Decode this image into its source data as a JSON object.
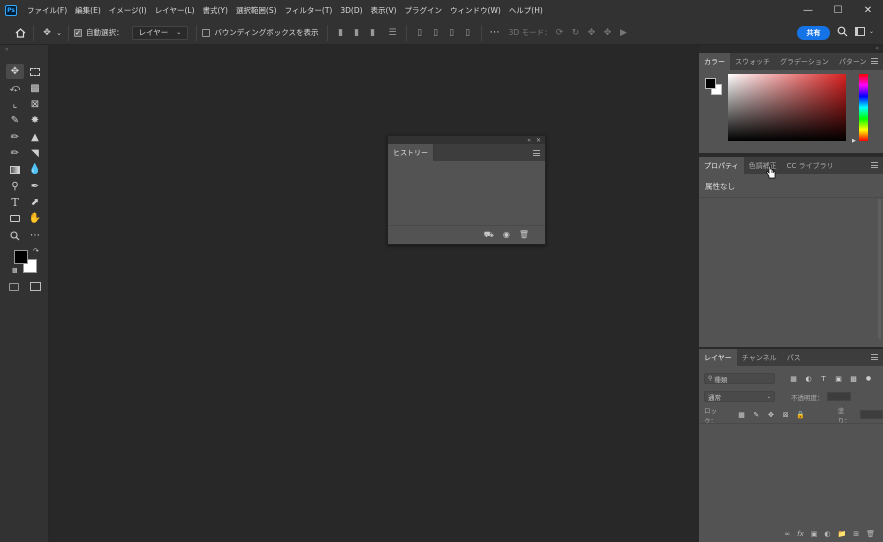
{
  "titlebar": {
    "app_icon": "Ps",
    "menu": [
      "ファイル(F)",
      "編集(E)",
      "イメージ(I)",
      "レイヤー(L)",
      "書式(Y)",
      "選択範囲(S)",
      "フィルター(T)",
      "3D(D)",
      "表示(V)",
      "プラグイン",
      "ウィンドウ(W)",
      "ヘルプ(H)"
    ],
    "window_controls": [
      "minimize-icon",
      "maximize-icon",
      "close-icon"
    ]
  },
  "options": {
    "auto_select_label": "自動選択：",
    "auto_select_checked": true,
    "auto_select_target": "レイヤー",
    "bbox_label": "バウンディングボックスを表示",
    "bbox_checked": false,
    "mode_3d_label": "3D モード：",
    "share_label": "共有"
  },
  "history_panel": {
    "tab_label": "ヒストリー"
  },
  "color_panel": {
    "tabs": [
      "カラー",
      "スウォッチ",
      "グラデーション",
      "パターン"
    ],
    "foreground": "#000000",
    "background": "#ffffff",
    "hue_color": "#d92020"
  },
  "properties_panel": {
    "tabs": [
      "プロパティ",
      "色調補正",
      "CC ライブラリ"
    ],
    "content": "属性なし"
  },
  "layers_panel": {
    "tabs": [
      "レイヤー",
      "チャンネル",
      "パス"
    ],
    "search_placeholder": "種類",
    "blend_mode": "通常",
    "opacity_label": "不透明度：",
    "lock_label": "ロック：",
    "fill_label": "塗り："
  },
  "colors": {
    "accent": "#1473e6",
    "panel": "#535353",
    "chrome": "#323232",
    "canvas": "#282828"
  }
}
